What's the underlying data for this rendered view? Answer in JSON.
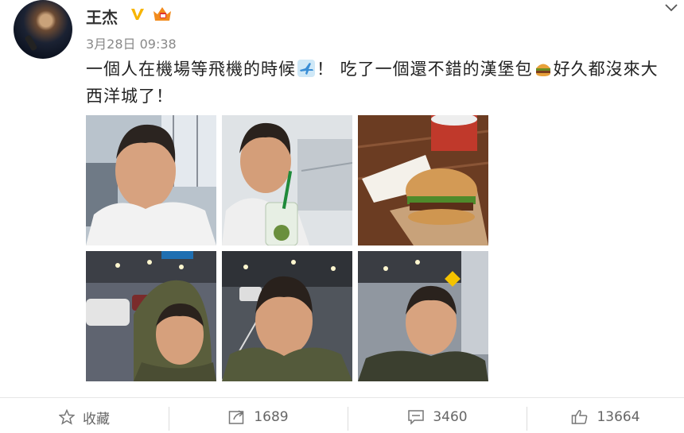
{
  "user": {
    "name": "王杰",
    "verified_icon": "verified-v-icon",
    "badge_icon": "vip-crown-icon"
  },
  "post": {
    "timestamp": "3月28日 09:38",
    "text_part1": "一個人在機場等飛機的時候",
    "emoji1": "airplane-icon",
    "text_part2": "！ 吃了一個還不錯的漢堡包",
    "emoji2": "hamburger-icon",
    "text_part3": "好久都沒來大西洋城了！"
  },
  "photos": [
    {
      "name": "photo-selfie-airport-1"
    },
    {
      "name": "photo-selfie-drink"
    },
    {
      "name": "photo-burger"
    },
    {
      "name": "photo-selfie-hooded"
    },
    {
      "name": "photo-selfie-garage"
    },
    {
      "name": "photo-selfie-outside"
    }
  ],
  "actions": {
    "favorite_label": "收藏",
    "repost_count": "1689",
    "comment_count": "3460",
    "like_count": "13664"
  },
  "colors": {
    "text": "#222222",
    "muted": "#888888",
    "verified": "#f7b500"
  }
}
